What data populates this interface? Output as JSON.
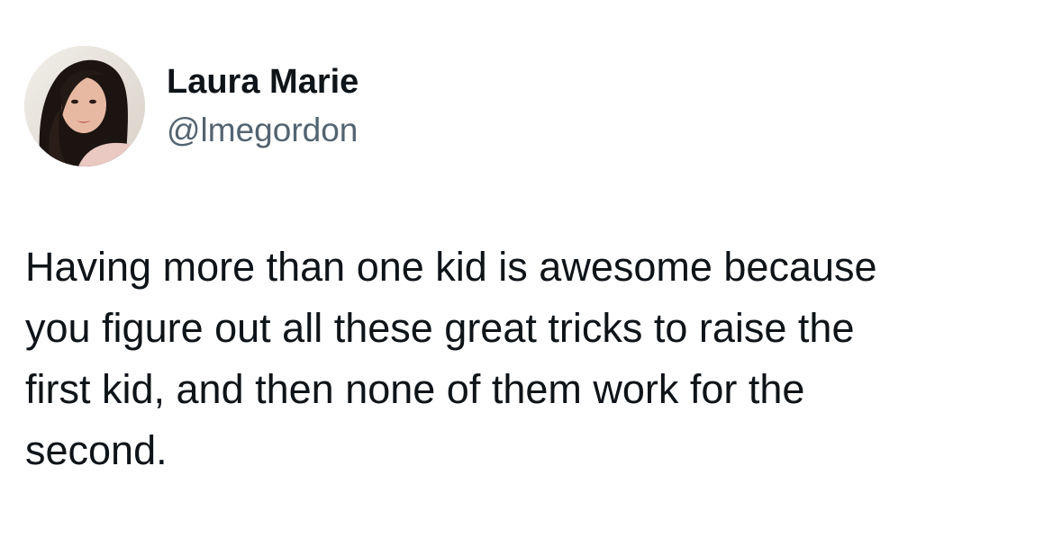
{
  "author": {
    "display_name": "Laura Marie",
    "handle": "@lmegordon",
    "avatar_icon": "profile-photo-avatar"
  },
  "tweet": {
    "text_lines": [
      "Having more than one kid is awesome because",
      "you figure out all these great tricks to raise the",
      "first kid, and then none of them work for the",
      "second."
    ]
  },
  "colors": {
    "primary_text": "#0f1419",
    "secondary_text": "#536471",
    "background": "#ffffff"
  }
}
